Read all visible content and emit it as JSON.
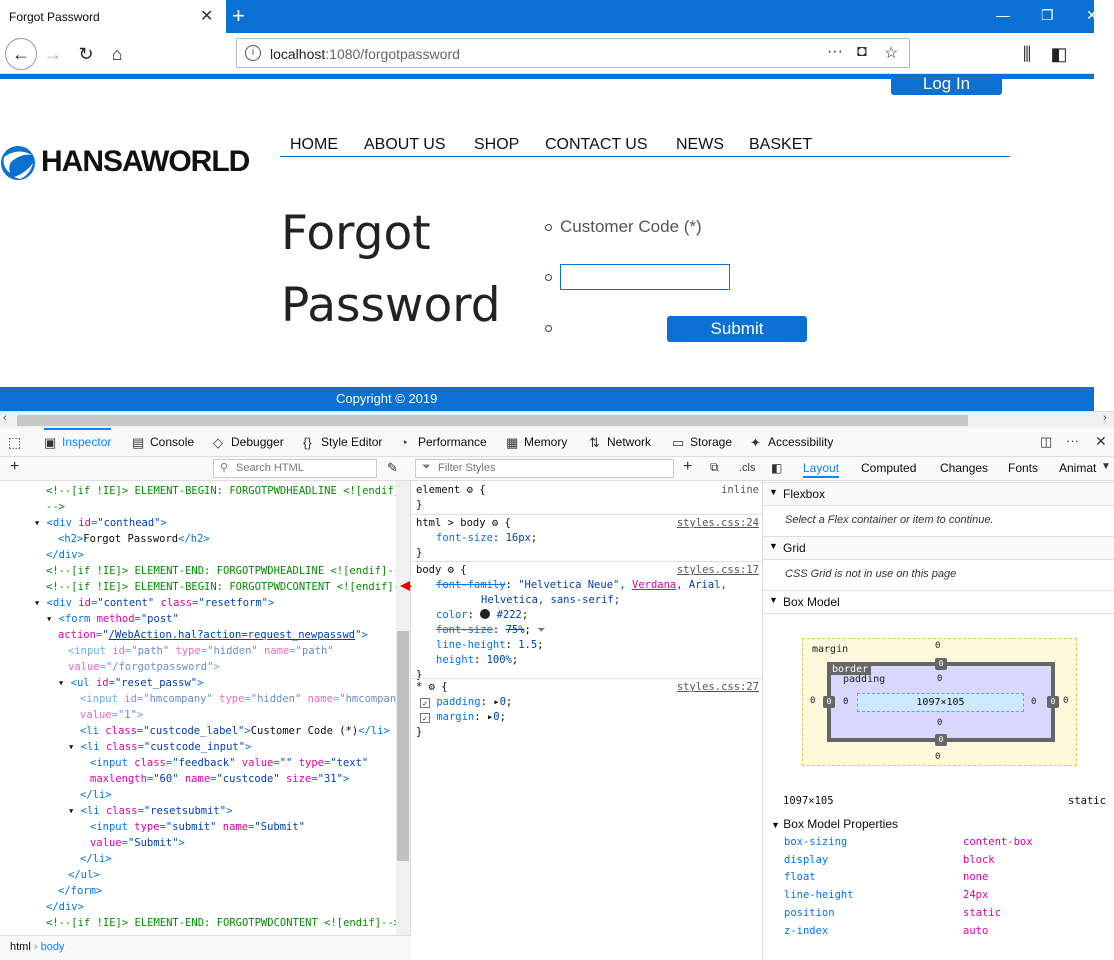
{
  "browser": {
    "tab_title": "Forgot Password",
    "url_host": "localhost",
    "url_path": ":1080/forgotpassword"
  },
  "page": {
    "login_label": "Log In",
    "logo_text": "HANSAWORLD",
    "nav": [
      "HOME",
      "ABOUT US",
      "SHOP",
      "CONTACT US",
      "NEWS",
      "BASKET"
    ],
    "headline_line1": "Forgot",
    "headline_line2": "Password",
    "custcode_label": "Customer Code (*)",
    "custcode_value": "",
    "submit_label": "Submit",
    "footer": "Copyright © 2019",
    "accent_color": "#0a70d2"
  },
  "devtools": {
    "tabs": [
      "Inspector",
      "Console",
      "Debugger",
      "Style Editor",
      "Performance",
      "Memory",
      "Network",
      "Storage",
      "Accessibility"
    ],
    "search_html_placeholder": "Search HTML",
    "filter_styles_placeholder": "Filter Styles",
    "cls_label": ".cls",
    "breadcrumb": [
      "html",
      "body"
    ],
    "layout_tabs": [
      "Layout",
      "Computed",
      "Changes",
      "Fonts",
      "Animat"
    ],
    "flexbox_title": "Flexbox",
    "flexbox_note": "Select a Flex container or item to continue.",
    "grid_title": "Grid",
    "grid_note": "CSS Grid is not in use on this page",
    "boxmodel_title": "Box Model",
    "boxmodel": {
      "margin_label": "margin",
      "border_label": "border",
      "padding_label": "padding",
      "content_size": "1097×105",
      "zero": "0"
    },
    "dimensions": "1097×105",
    "position_label": "static",
    "bm_props_title": "Box Model Properties",
    "bm_props": [
      {
        "name": "box-sizing",
        "value": "content-box"
      },
      {
        "name": "display",
        "value": "block"
      },
      {
        "name": "float",
        "value": "none"
      },
      {
        "name": "line-height",
        "value": "24px"
      },
      {
        "name": "position",
        "value": "static"
      },
      {
        "name": "z-index",
        "value": "auto"
      }
    ],
    "rules": {
      "element_sel": "element",
      "element_src": "inline",
      "html_body_sel": "html > body",
      "html_body_src": "styles.css:24",
      "fs16_prop": "font-size",
      "fs16_val": "16px",
      "body_sel": "body",
      "body_src": "styles.css:17",
      "ff_prop": "font-family",
      "ff_val": "\"Helvetica Neue\", ",
      "ff_verdana": "Verdana",
      "ff_arial": ", Arial,",
      "ff_val2": "Helvetica, sans-serif;",
      "color_prop": "color",
      "color_val": "#222",
      "fs75_prop": "font-size",
      "fs75_val": "75%",
      "lh_prop": "line-height",
      "lh_val": "1.5",
      "height_prop": "height",
      "height_val": "100%",
      "star_sel": "*",
      "star_src": "styles.css:27",
      "padding_prop": "padding",
      "margin_prop": "margin",
      "zero_val": "0"
    }
  }
}
